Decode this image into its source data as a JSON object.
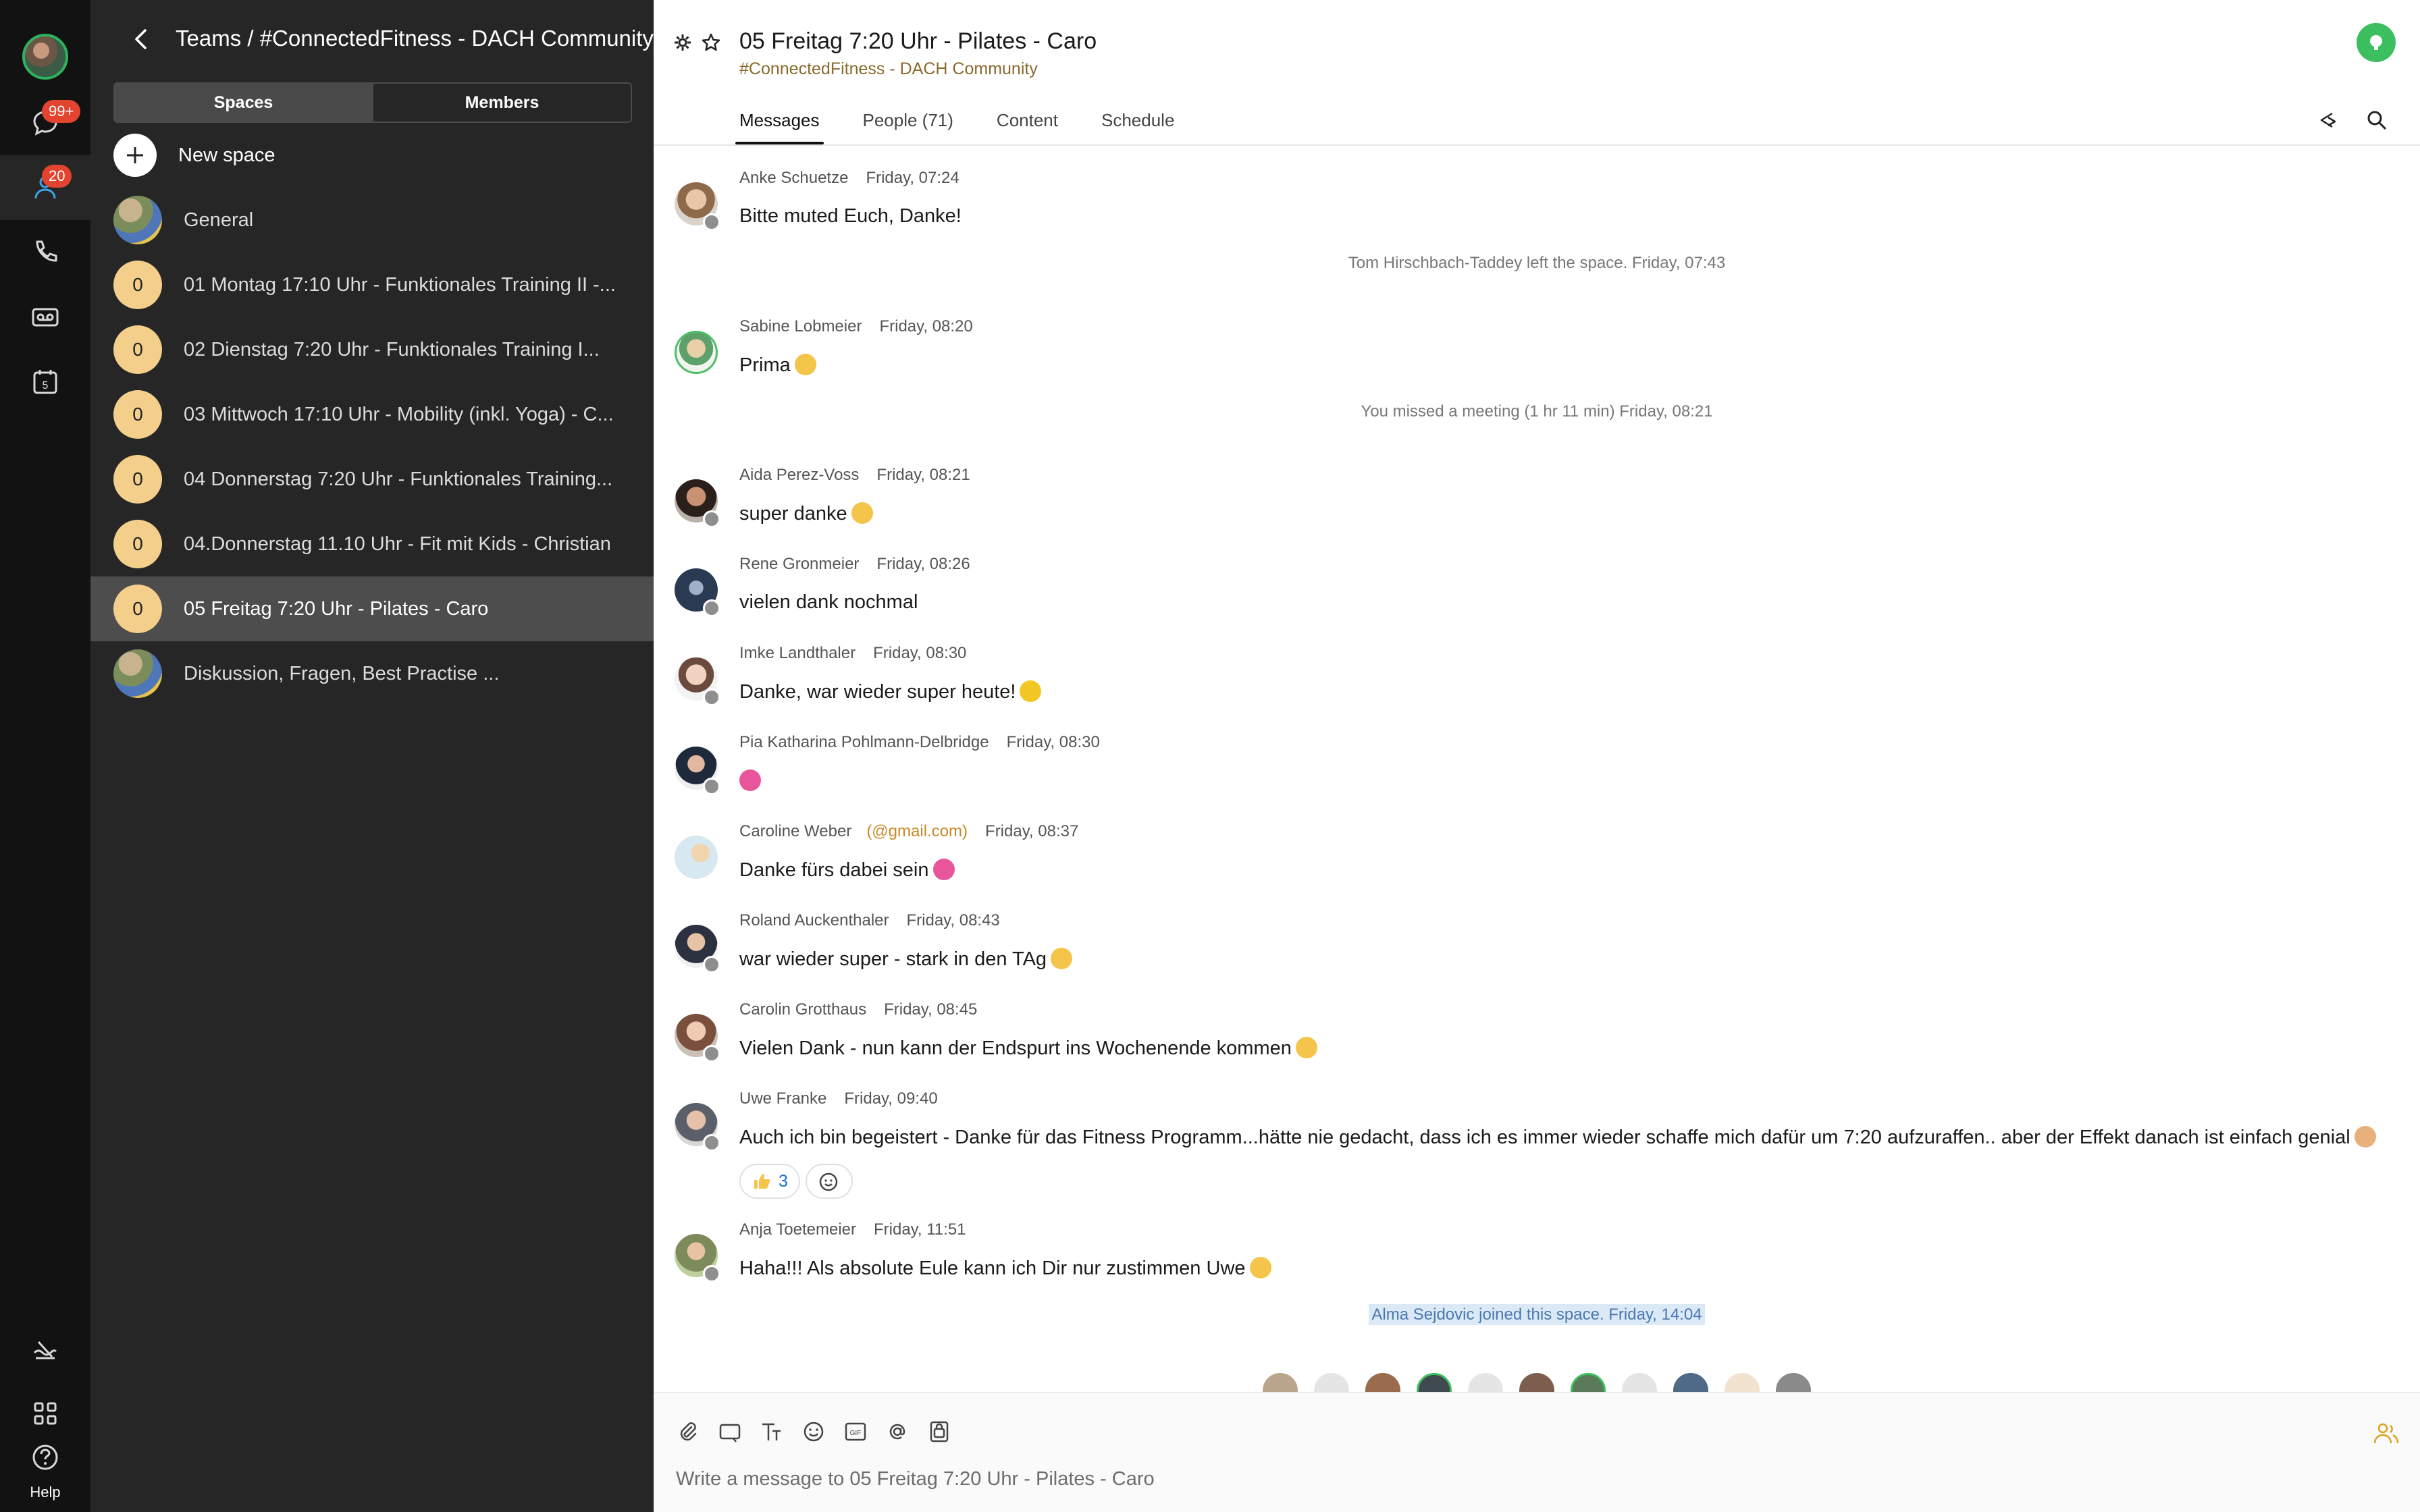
{
  "rail": {
    "messaging_badge": "99+",
    "teams_badge": "20",
    "calendar_day": "5",
    "help_label": "Help"
  },
  "spaces_panel": {
    "title": "Teams / #ConnectedFitness - DACH Community",
    "tabs": {
      "spaces": "Spaces",
      "members": "Members"
    },
    "new_space_label": "New space",
    "items": [
      {
        "badge": "",
        "name": "General"
      },
      {
        "badge": "0",
        "name": "01 Montag 17:10 Uhr - Funktionales Training II -..."
      },
      {
        "badge": "0",
        "name": "02 Dienstag 7:20 Uhr  -  Funktionales Training I..."
      },
      {
        "badge": "0",
        "name": "03 Mittwoch 17:10 Uhr - Mobility (inkl. Yoga) - C..."
      },
      {
        "badge": "0",
        "name": "04 Donnerstag 7:20 Uhr - Funktionales Training..."
      },
      {
        "badge": "0",
        "name": "04.Donnerstag 11.10 Uhr - Fit mit Kids - Christian"
      },
      {
        "badge": "0",
        "name": "05 Freitag 7:20 Uhr - Pilates - Caro"
      },
      {
        "badge": "",
        "name": "Diskussion, Fragen, Best Practise ..."
      }
    ]
  },
  "header": {
    "title": "05 Freitag 7:20 Uhr - Pilates - Caro",
    "subtitle": "#ConnectedFitness - DACH Community",
    "tabs": [
      "Messages",
      "People (71)",
      "Content",
      "Schedule"
    ]
  },
  "messages": [
    {
      "name": "Anke Schuetze",
      "email": "",
      "time": "Friday, 07:24",
      "text": "Bitte muted Euch, Danke!"
    },
    {
      "system": "Tom Hirschbach-Taddey left the space. Friday, 07:43"
    },
    {
      "name": "Sabine Lobmeier",
      "email": "",
      "time": "Friday, 08:20",
      "text": "Prima"
    },
    {
      "system": "You missed a meeting (1 hr 11 min) Friday, 08:21"
    },
    {
      "name": "Aida Perez-Voss",
      "email": "",
      "time": "Friday, 08:21",
      "text": "super danke"
    },
    {
      "name": "Rene Gronmeier",
      "email": "",
      "time": "Friday, 08:26",
      "text": "vielen dank nochmal"
    },
    {
      "name": "Imke Landthaler",
      "email": "",
      "time": "Friday, 08:30",
      "text": "Danke, war wieder super heute!"
    },
    {
      "name": "Pia Katharina Pohlmann-Delbridge",
      "email": "",
      "time": "Friday, 08:30",
      "text": ""
    },
    {
      "name": "Caroline Weber",
      "email": "(@gmail.com)",
      "time": "Friday, 08:37",
      "text": "Danke fürs dabei sein"
    },
    {
      "name": "Roland Auckenthaler",
      "email": "",
      "time": "Friday, 08:43",
      "text": "war wieder super - stark in den TAg"
    },
    {
      "name": "Carolin Grotthaus",
      "email": "",
      "time": "Friday, 08:45",
      "text": "Vielen Dank - nun kann der Endspurt ins Wochenende kommen"
    },
    {
      "name": "Uwe Franke",
      "email": "",
      "time": "Friday, 09:40",
      "text": "Auch ich bin begeistert - Danke für das Fitness Programm...hätte nie gedacht, dass ich es immer wieder schaffe mich dafür um 7:20 aufzuraffen.. aber der Effekt danach ist einfach genial",
      "reaction_count": "3"
    },
    {
      "name": "Anja Toetemeier",
      "email": "",
      "time": "Friday, 11:51",
      "text": "Haha!!! Als absolute Eule kann ich Dir nur zustimmen Uwe"
    },
    {
      "system": "Alma Sejdovic joined this space. Friday, 14:04"
    }
  ],
  "composer": {
    "placeholder": "Write a message to 05 Freitag 7:20 Uhr - Pilates - Caro"
  },
  "colors": {
    "rail_bg": "#121212",
    "panel_bg": "#262626",
    "selected_bg": "#4d4d4d",
    "space_badge": "#f3cf8b",
    "notification_badge": "#e2442f",
    "call_green": "#3cbf5e",
    "subtitle": "#8a6a2c",
    "email": "#c98a26"
  }
}
